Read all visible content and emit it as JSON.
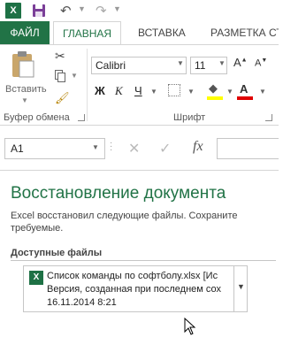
{
  "qat": {
    "app_icon": "excel-icon",
    "save": "save-icon",
    "undo": "undo-icon",
    "redo": "redo-icon"
  },
  "tabs": {
    "file": "ФАЙЛ",
    "home": "ГЛАВНАЯ",
    "insert": "ВСТАВКА",
    "layout": "РАЗМЕТКА СТ"
  },
  "ribbon": {
    "paste_label": "Вставить",
    "clipboard_label": "Буфер обмена",
    "font_label": "Шрифт",
    "font_name": "Calibri",
    "font_size": "11",
    "bold": "Ж",
    "italic": "К",
    "underline": "Ч",
    "fill_color": "#ffff00",
    "font_color": "#e00000"
  },
  "formula_bar": {
    "name_box": "A1",
    "fx": "fx",
    "value": ""
  },
  "recovery": {
    "title": "Восстановление документа",
    "message": "Excel восстановил следующие файлы.  Сохраните требуемые.",
    "available_label": "Доступные файлы",
    "file": {
      "name": "Список команды по софтболу.xlsx  [Ис",
      "description": "Версия, созданная при последнем сох",
      "date": "16.11.2014 8:21"
    }
  },
  "colors": {
    "accent": "#217346"
  }
}
